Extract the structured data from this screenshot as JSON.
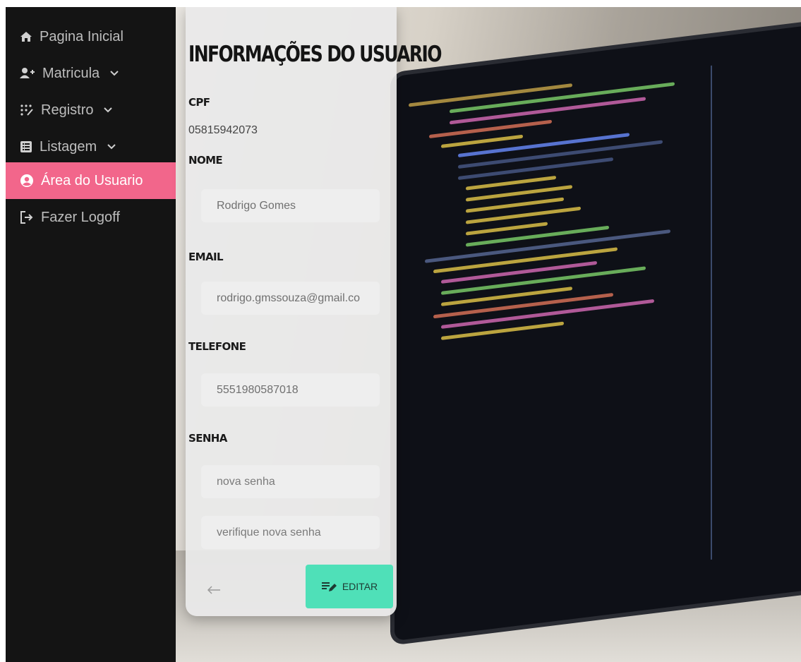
{
  "sidebar": {
    "items": [
      {
        "label": "Pagina Inicial",
        "icon": "home-icon",
        "dropdown": false,
        "active": false
      },
      {
        "label": "Matricula",
        "icon": "user-plus-icon",
        "dropdown": true,
        "active": false
      },
      {
        "label": "Registro",
        "icon": "dots-grid-icon",
        "dropdown": true,
        "active": false
      },
      {
        "label": "Listagem",
        "icon": "list-icon",
        "dropdown": true,
        "active": false
      },
      {
        "label": "Área do Usuario",
        "icon": "user-circle-icon",
        "dropdown": false,
        "active": true
      },
      {
        "label": "Fazer Logoff",
        "icon": "logout-icon",
        "dropdown": false,
        "active": false
      }
    ]
  },
  "card": {
    "title": "INFORMAÇÕES DO USUARIO",
    "cpf_label": "CPF",
    "cpf_value": "05815942073",
    "nome_label": "NOME",
    "nome_value": "Rodrigo Gomes",
    "email_label": "EMAIL",
    "email_value": "rodrigo.gmssouza@gmail.co",
    "telefone_label": "TELEFONE",
    "telefone_value": "5551980587018",
    "senha_label": "SENHA",
    "nova_senha_placeholder": "nova senha",
    "verifique_senha_placeholder": "verifique nova senha",
    "edit_label": "EDITAR"
  },
  "colors": {
    "sidebar_bg": "#141414",
    "active_item": "#f2668b",
    "edit_button": "#4fe0b8",
    "card_bg": "#e9e9e9"
  }
}
